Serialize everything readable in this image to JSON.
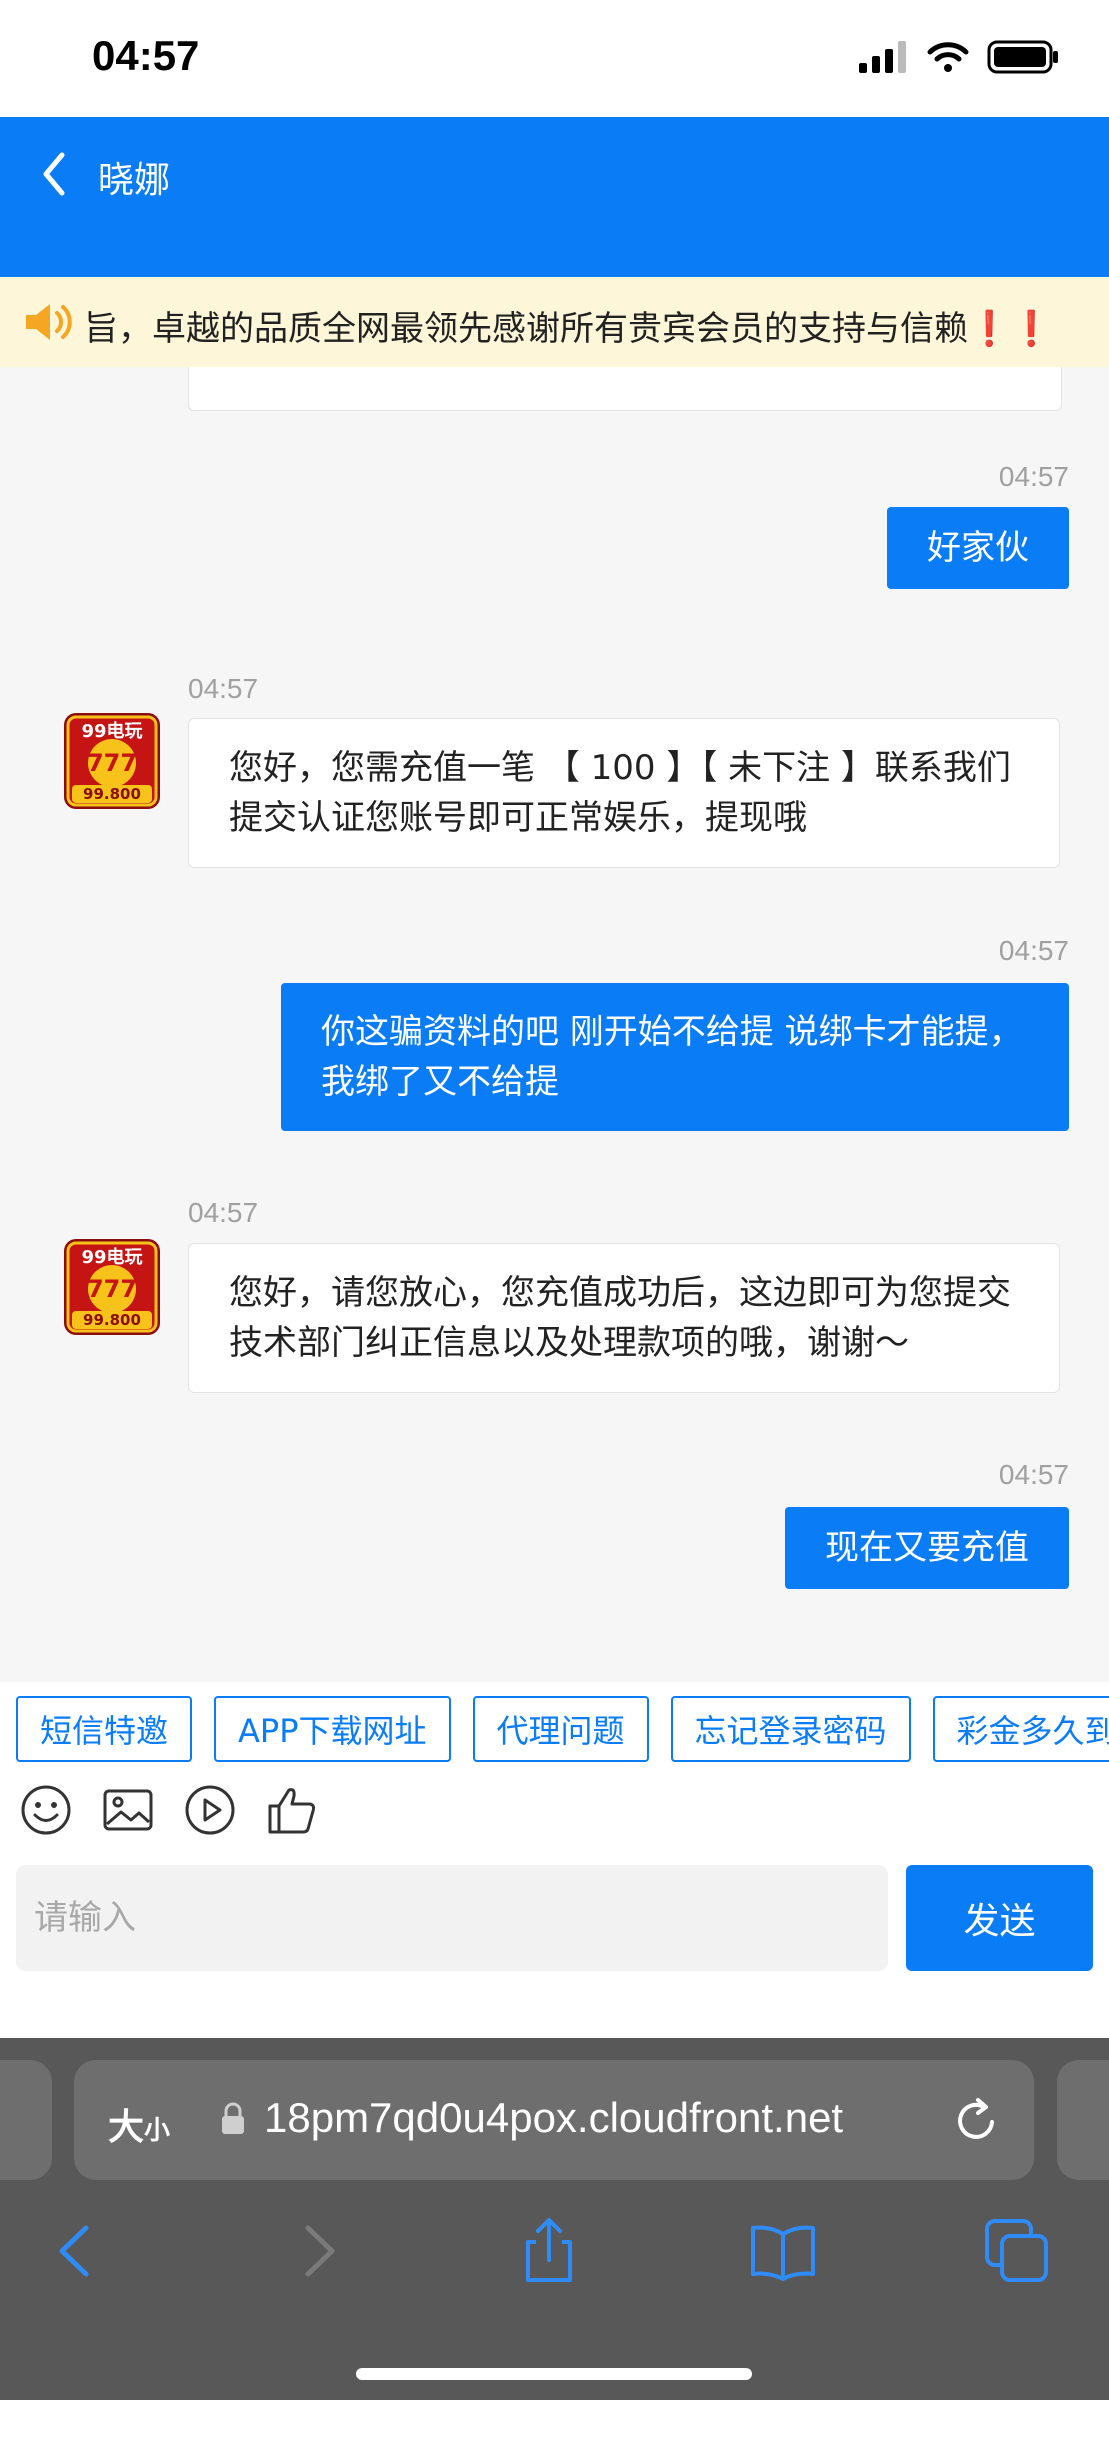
{
  "status_bar": {
    "time": "04:57"
  },
  "header": {
    "title": "晓娜"
  },
  "announcement": {
    "text": "旨，卓越的品质全网最领先感谢所有贵宾会员的支持与信赖",
    "suffix": "❗❗"
  },
  "messages": [
    {
      "side": "right",
      "time": "04:57",
      "text": "好家伙"
    },
    {
      "side": "left",
      "time": "04:57",
      "text": "您好，您需充值一笔 【 100 】【 未下注 】联系我们提交认证您账号即可正常娱乐，提现哦"
    },
    {
      "side": "right",
      "time": "04:57",
      "text": "你这骗资料的吧 刚开始不给提 说绑卡才能提，我绑了又不给提"
    },
    {
      "side": "left",
      "time": "04:57",
      "text": "您好，请您放心，您充值成功后，这边即可为您提交技术部门纠正信息以及处理款项的哦，谢谢～"
    },
    {
      "side": "right",
      "time": "04:57",
      "text": "现在又要充值"
    }
  ],
  "avatar": {
    "line1": "99电玩",
    "line2": "99.800"
  },
  "quick_replies": [
    "短信特邀",
    "APP下载网址",
    "代理问题",
    "忘记登录密码",
    "彩金多久到账"
  ],
  "input": {
    "placeholder": "请输入",
    "value": ""
  },
  "send_label": "发送",
  "browser": {
    "text_size_label": "大",
    "text_size_small": "小",
    "url": "18pm7qd0u4pox.cloudfront.net"
  },
  "colors": {
    "primary": "#0a7cf5",
    "banner_bg": "#fdf6d8",
    "browser_bg": "#585858"
  }
}
